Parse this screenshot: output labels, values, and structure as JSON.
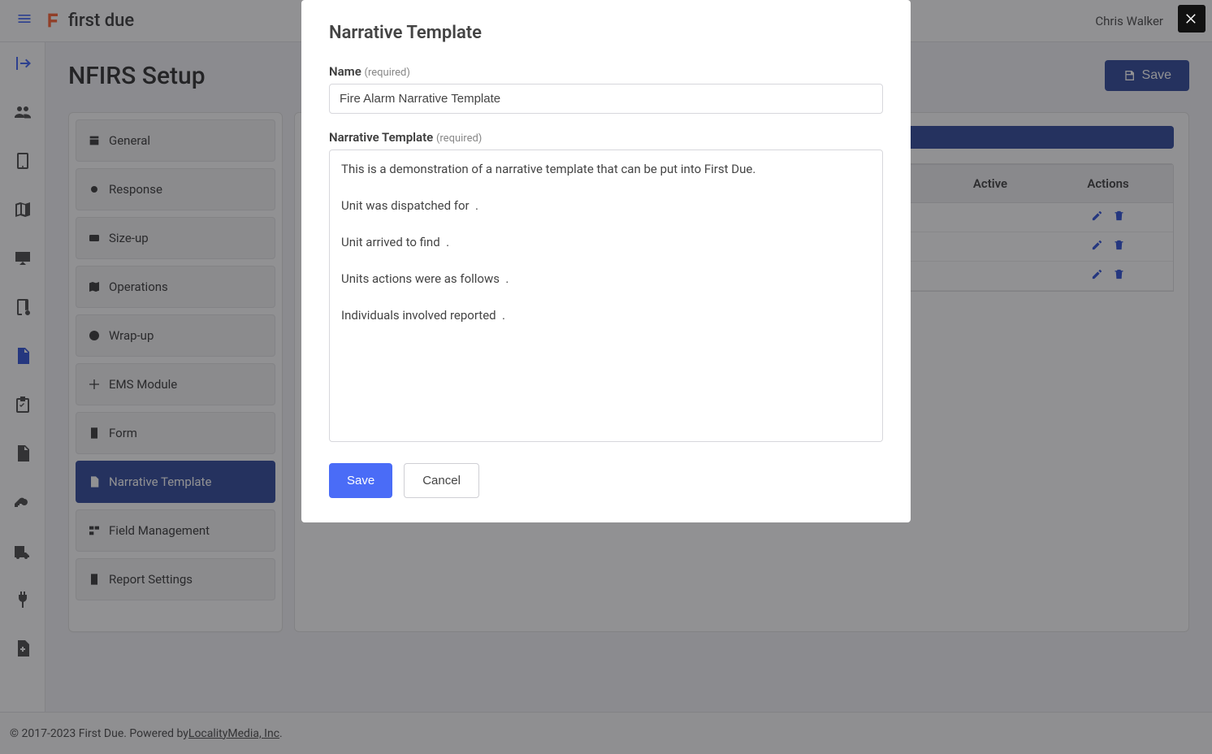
{
  "header": {
    "brand": "first due",
    "user": "Chris Walker"
  },
  "page": {
    "title": "NFIRS Setup",
    "save_label": "Save"
  },
  "side_nav": {
    "items": [
      {
        "label": "General"
      },
      {
        "label": "Response"
      },
      {
        "label": "Size-up"
      },
      {
        "label": "Operations"
      },
      {
        "label": "Wrap-up"
      },
      {
        "label": "EMS Module"
      },
      {
        "label": "Form"
      },
      {
        "label": "Narrative Template"
      },
      {
        "label": "Field Management"
      },
      {
        "label": "Report Settings"
      }
    ],
    "active_index": 7
  },
  "table": {
    "columns": {
      "active": "Active",
      "actions": "Actions"
    }
  },
  "footer": {
    "prefix": "© 2017-2023 First Due. Powered by ",
    "link": "LocalityMedia, Inc",
    "suffix": "."
  },
  "modal": {
    "title": "Narrative Template",
    "name_label": "Name",
    "required_suffix": "(required)",
    "name_value": "Fire Alarm Narrative Template",
    "template_label": "Narrative Template",
    "template_value": "This is a demonstration of a narrative template that can be put into First Due.\n\nUnit was dispatched for  .\n\nUnit arrived to find  .\n\nUnits actions were as follows  .\n\nIndividuals involved reported  .",
    "save_label": "Save",
    "cancel_label": "Cancel"
  }
}
